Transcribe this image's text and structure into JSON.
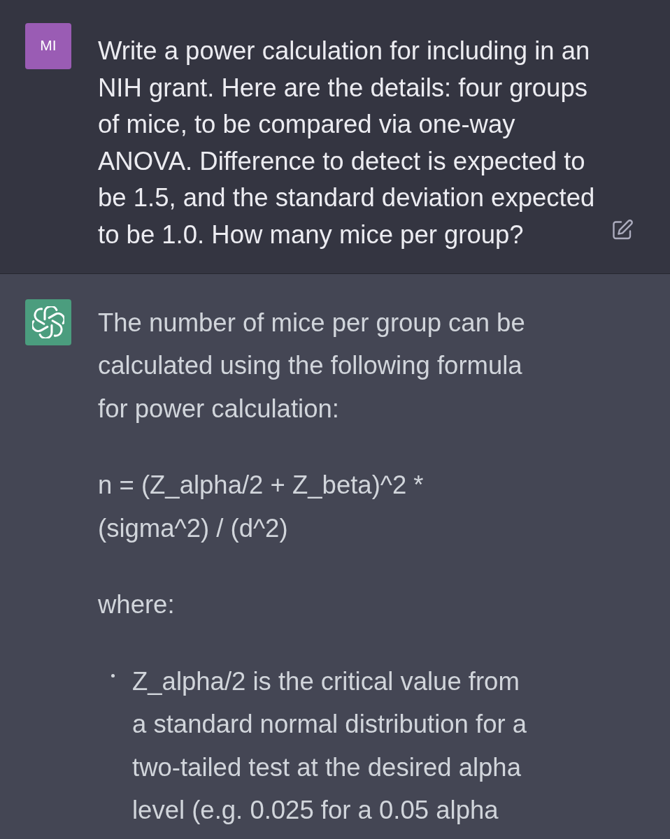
{
  "messages": [
    {
      "kind": "user",
      "avatar": "MI",
      "blocks": [
        {
          "kind": "paragraph",
          "text": "Write a power calculation for including in an NIH grant. Here are the details: four groups of mice, to be compared via one-way ANOVA. Difference to detect is expected to be 1.5, and the standard deviation expected to be 1.0. How many mice per group?"
        }
      ]
    },
    {
      "kind": "assistant",
      "blocks": [
        {
          "kind": "paragraph",
          "text": "The number of mice per group can be calculated using the following formula for power calculation:"
        },
        {
          "kind": "paragraph",
          "text": "n = (Z_alpha/2 + Z_beta)^2 * (sigma^2) / (d^2)"
        },
        {
          "kind": "paragraph",
          "text": "where:"
        },
        {
          "kind": "list",
          "items": [
            "Z_alpha/2 is the critical value from a standard normal distribution for a two-tailed test at the desired alpha level (e.g. 0.025 for a 0.05 alpha"
          ]
        }
      ]
    }
  ]
}
